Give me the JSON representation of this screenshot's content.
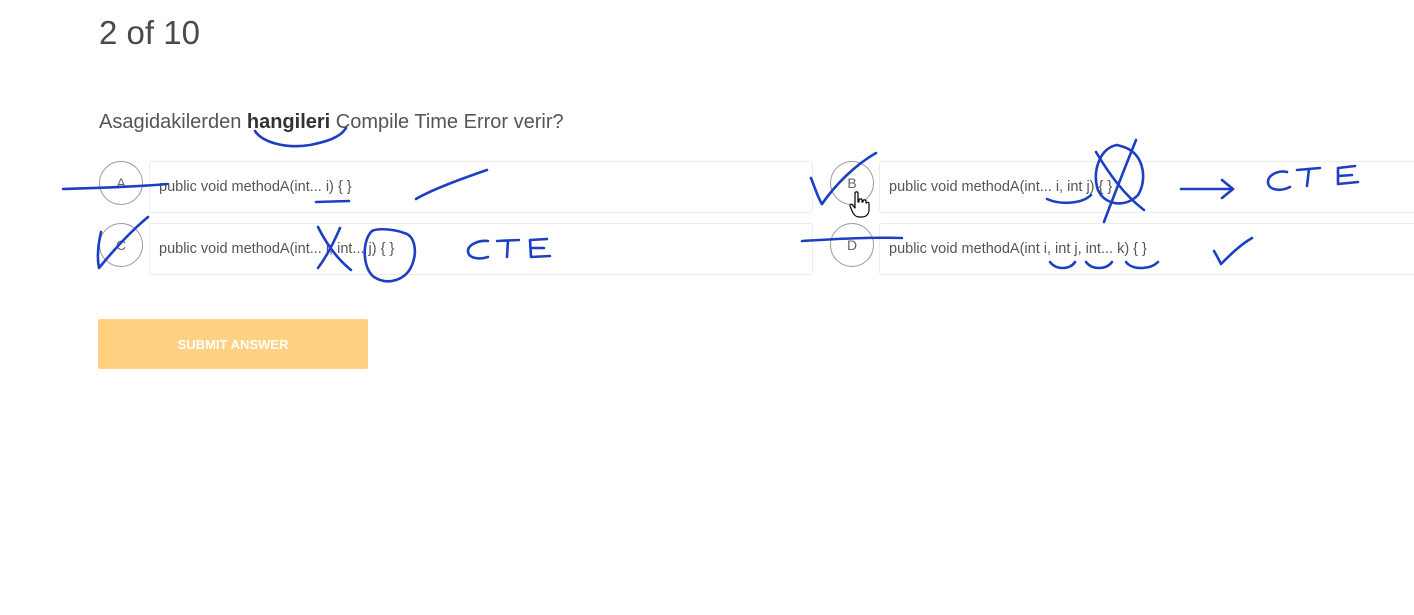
{
  "counter": "2 of 10",
  "question": {
    "before": "Asagidakilerden ",
    "bold": "hangileri",
    "after": " Compile Time Error verir?"
  },
  "options": [
    {
      "letter": "A",
      "text": "public void methodA(int... i) { }"
    },
    {
      "letter": "B",
      "text": "public void methodA(int... i, int j) { }"
    },
    {
      "letter": "C",
      "text": "public void methodA(int... i, int... j) { }"
    },
    {
      "letter": "D",
      "text": "public void methodA(int i, int j, int... k) { }"
    }
  ],
  "submit_label": "SUBMIT ANSWER",
  "annotations": {
    "cte_b": "CTE",
    "cte_c": "CTE"
  },
  "colors": {
    "ink": "#1d3fc4",
    "submit": "#ffd181"
  }
}
